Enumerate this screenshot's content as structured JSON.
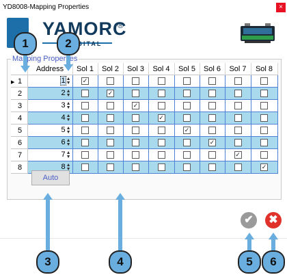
{
  "window": {
    "title": "YD8008-Mapping Properties",
    "close_glyph": "×"
  },
  "logo": {
    "brand": "YAMORC",
    "reg": "®",
    "sub": "DIGITAL"
  },
  "group": {
    "legend": "Mapping Properties"
  },
  "grid": {
    "columns": [
      "Address",
      "Sol 1",
      "Sol 2",
      "Sol 3",
      "Sol 4",
      "Sol 5",
      "Sol 6",
      "Sol 7",
      "Sol 8"
    ],
    "rows": [
      {
        "index": "1",
        "address": "1",
        "checked": [
          true,
          false,
          false,
          false,
          false,
          false,
          false,
          false
        ]
      },
      {
        "index": "2",
        "address": "2",
        "checked": [
          false,
          true,
          false,
          false,
          false,
          false,
          false,
          false
        ]
      },
      {
        "index": "3",
        "address": "3",
        "checked": [
          false,
          false,
          true,
          false,
          false,
          false,
          false,
          false
        ]
      },
      {
        "index": "4",
        "address": "4",
        "checked": [
          false,
          false,
          false,
          true,
          false,
          false,
          false,
          false
        ]
      },
      {
        "index": "5",
        "address": "5",
        "checked": [
          false,
          false,
          false,
          false,
          true,
          false,
          false,
          false
        ]
      },
      {
        "index": "6",
        "address": "6",
        "checked": [
          false,
          false,
          false,
          false,
          false,
          true,
          false,
          false
        ]
      },
      {
        "index": "7",
        "address": "7",
        "checked": [
          false,
          false,
          false,
          false,
          false,
          false,
          true,
          false
        ]
      },
      {
        "index": "8",
        "address": "8",
        "checked": [
          false,
          false,
          false,
          false,
          false,
          false,
          false,
          true
        ]
      }
    ],
    "current_row_marker": "▶"
  },
  "buttons": {
    "auto": "Auto",
    "ok_glyph": "✔",
    "cancel_glyph": "✖"
  },
  "callouts": [
    "1",
    "2",
    "3",
    "4",
    "5",
    "6"
  ],
  "colors": {
    "alt_row": "#a8d9ec",
    "grid_line": "#4d80d6",
    "callout": "#6aaee0",
    "cancel": "#e0322b"
  }
}
